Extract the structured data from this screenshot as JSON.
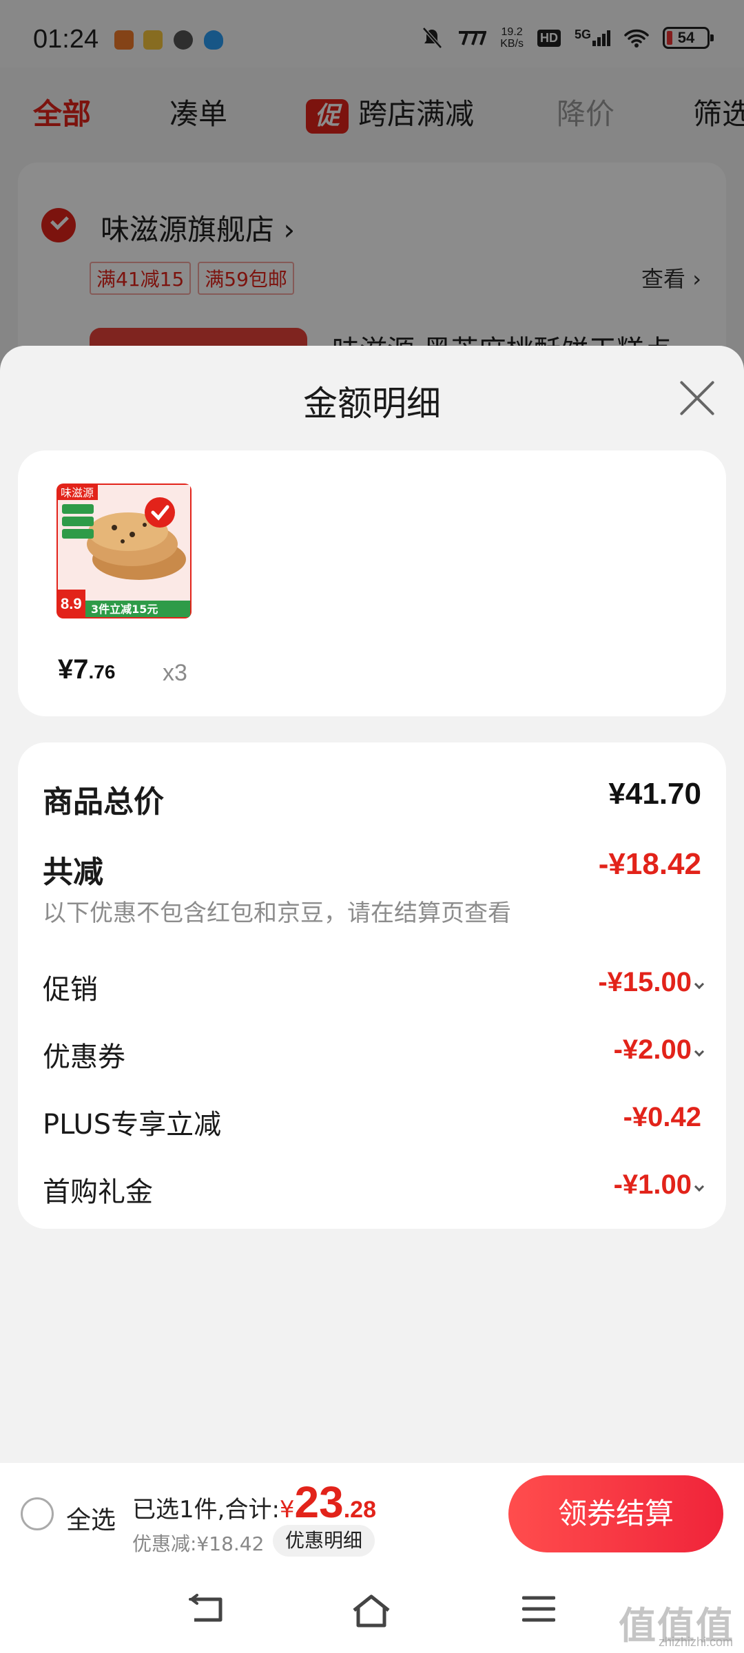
{
  "status_bar": {
    "time": "01:24",
    "net_speed_value": "19.2",
    "net_speed_unit": "KB/s",
    "hd": "HD",
    "network": "5G",
    "battery": "54"
  },
  "tabs": {
    "all": "全部",
    "bundle": "凑单",
    "promo_badge": "促",
    "cross_store": "跨店满减",
    "price_drop": "降价",
    "filter": "筛选"
  },
  "store": {
    "name": "味滋源旗舰店",
    "tags": [
      "满41减15",
      "满59包邮"
    ],
    "view_label": "查看",
    "product_title": "味滋源 黑芝麻桃酥饼干糕点"
  },
  "sheet": {
    "title": "金额明细",
    "product": {
      "price_int": "¥7",
      "price_dec": ".76",
      "quantity": "x3",
      "image_price_tag": "8.9",
      "image_banner": "3件立减15元",
      "image_brand": "味滋源"
    },
    "details": {
      "total_label": "商品总价",
      "total_value": "¥41.70",
      "reduce_label": "共减",
      "reduce_value": "-¥18.42",
      "note": "以下优惠不包含红包和京豆，请在结算页查看",
      "items": [
        {
          "label": "促销",
          "value": "-¥15.00",
          "expandable": true
        },
        {
          "label": "优惠券",
          "value": "-¥2.00",
          "expandable": true
        },
        {
          "label": "PLUS专享立减",
          "value": "-¥0.42",
          "expandable": false
        },
        {
          "label": "首购礼金",
          "value": "-¥1.00",
          "expandable": true
        }
      ]
    }
  },
  "checkout": {
    "select_all": "全选",
    "selected_prefix": "已选1件,合计:",
    "yen": "¥",
    "total_int": "23",
    "total_dec": ".28",
    "saved": "优惠减:¥18.42",
    "detail_button": "优惠明细",
    "pay_button": "领券结算"
  },
  "watermark": {
    "text": "值值值",
    "domain": "zhizhizhi.com"
  },
  "colors": {
    "accent": "#e2231a",
    "pay_button": "#f0243a",
    "muted_text": "#8c8c8c"
  }
}
